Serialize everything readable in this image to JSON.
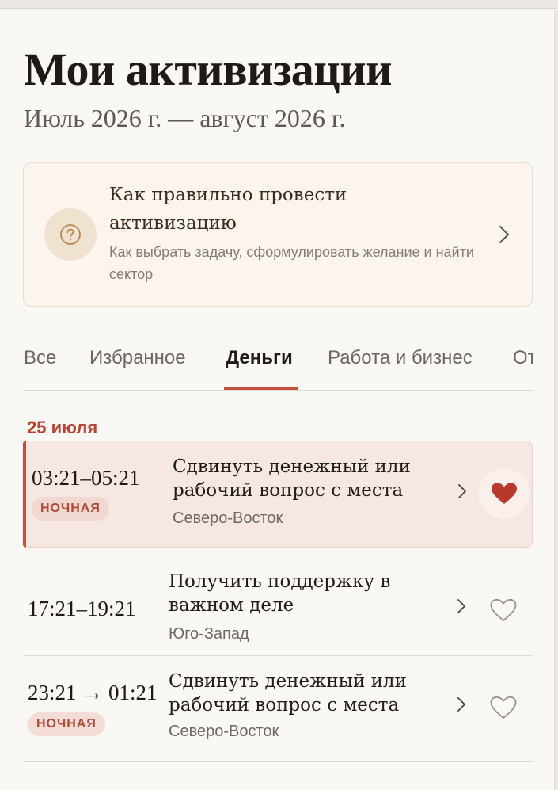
{
  "header": {
    "title": "Мои активизации",
    "period": "Июль 2026 г. — август 2026 г."
  },
  "guide_card": {
    "icon": "question-circle-icon",
    "title": "Как правильно провести активизацию",
    "description": "Как выбрать задачу, сформулировать желание и найти сектор"
  },
  "tabs": [
    {
      "label": "Все",
      "active": false
    },
    {
      "label": "Избранное",
      "active": false
    },
    {
      "label": "Деньги",
      "active": true
    },
    {
      "label": "Работа и бизнес",
      "active": false
    },
    {
      "label": "Отношения",
      "active": false
    }
  ],
  "date_group": {
    "label": "25 июля"
  },
  "activations": [
    {
      "time": "03:21–05:21",
      "badge": "НОЧНАЯ",
      "title": "Сдвинуть денежный или рабочий вопрос с места",
      "sector": "Северо-Восток",
      "favorite": true,
      "highlighted": true
    },
    {
      "time": "17:21–19:21",
      "badge": "",
      "title": "Получить поддержку в важном деле",
      "sector": "Юго-Запад",
      "favorite": false,
      "highlighted": false
    },
    {
      "time": "23:21 → 01:21",
      "badge": "НОЧНАЯ",
      "title": "Сдвинуть денежный или рабочий вопрос с места",
      "sector": "Северо-Восток",
      "favorite": false,
      "highlighted": false
    }
  ],
  "colors": {
    "accent": "#c1503c",
    "heart_filled": "#b8392b",
    "background": "#faf8f5"
  }
}
